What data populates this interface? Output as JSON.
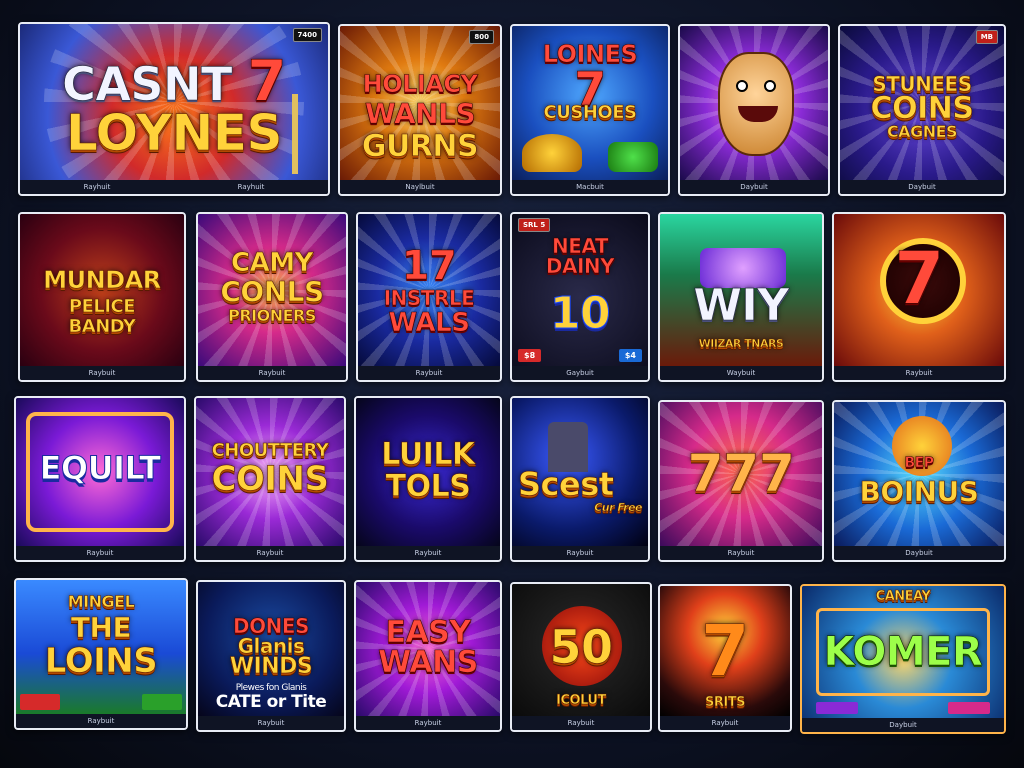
{
  "rows": [
    [
      {
        "title": "CASNT 7\nLOYNES",
        "badge": "7400",
        "caption": [
          "Rayhuit",
          "Rayhuit"
        ]
      },
      {
        "title": "HOLIACY\nWANLS\nGURNS",
        "badge": "800",
        "caption": [
          "Naylbuit"
        ]
      },
      {
        "title": "LOINES\n7\nCUSHOES",
        "caption": [
          "Macbuit"
        ]
      },
      {
        "title": "",
        "caption": [
          "Daybuit"
        ]
      },
      {
        "title": "STUNEES\nCOINS\nCAGNES",
        "badge": "MB",
        "caption": [
          "Daybuit"
        ]
      }
    ],
    [
      {
        "title": "MUNDAR\nPELICE\nBANDY",
        "caption": [
          "Raybuit"
        ]
      },
      {
        "title": "CAMY\nCONLS\nPRIONERS",
        "caption": [
          "Raybuit"
        ]
      },
      {
        "title": "17\nINSTRLE\nWALS",
        "caption": [
          "Raybuit"
        ]
      },
      {
        "title": "NEAT\nDAINY\n10",
        "badge": "SRL 5",
        "btn_left": "$8",
        "btn_right": "$4",
        "caption": [
          "Gaybuit"
        ]
      },
      {
        "title": "WIY\nWIIZAR TNARS",
        "caption": [
          "Waybuit"
        ]
      },
      {
        "title": "7",
        "caption": [
          "Raybuit"
        ]
      }
    ],
    [
      {
        "title": "EQUILT",
        "caption": [
          "Raybuit"
        ]
      },
      {
        "title": "CHOUTTERY\nCOINS",
        "caption": [
          "Raybuit"
        ]
      },
      {
        "title": "LUILK\nTOLS",
        "caption": [
          "Raybuit"
        ]
      },
      {
        "title": "Scest\nCur Free",
        "caption": [
          "Raybuit"
        ]
      },
      {
        "title": "777",
        "caption": [
          "Raybuit"
        ]
      },
      {
        "title": "BEP\nBOINUS",
        "caption": [
          "Daybuit"
        ]
      }
    ],
    [
      {
        "title": "MINGEL\nTHE\nLOINS",
        "caption": [
          "Raybuit"
        ]
      },
      {
        "title": "DONES\nGlanis\nWINDS\nPlewes fon Glanis\nCATE or Tite",
        "caption": [
          "Raybuit"
        ]
      },
      {
        "title": "EASY\nWANS",
        "caption": [
          "Raybuit"
        ]
      },
      {
        "title": "50\nICOLUT",
        "caption": [
          "Raybuit"
        ]
      },
      {
        "title": "7\nSRITS",
        "caption": [
          "Raybuit"
        ]
      },
      {
        "title": "CANEAY\nKOMER",
        "caption": [
          "Daybuit"
        ]
      }
    ]
  ],
  "labels": {
    "r1c1_line1": "CASNT",
    "r1c1_seven": "7",
    "r1c1_line2": "LOYNES",
    "r1c1_badge": "7400",
    "r1c1_cap_a": "Rayhuit",
    "r1c1_cap_b": "Rayhuit",
    "r1c2_line1": "HOLIACY",
    "r1c2_line2": "WANLS",
    "r1c2_line3": "GURNS",
    "r1c2_badge": "800",
    "r1c2_cap": "Naylbuit",
    "r1c3_line1": "LOINES",
    "r1c3_seven": "7",
    "r1c3_line2": "CUSHOES",
    "r1c3_cap": "Macbuit",
    "r1c4_cap": "Daybuit",
    "r1c5_line1": "STUNEES",
    "r1c5_line2": "COINS",
    "r1c5_line3": "CAGNES",
    "r1c5_badge": "MB",
    "r1c5_cap": "Daybuit",
    "r2c1_line1": "MUNDAR",
    "r2c1_line2": "PELICE",
    "r2c1_line3": "BANDY",
    "r2c1_cap": "Raybuit",
    "r2c2_line1": "CAMY",
    "r2c2_line2": "CONLS",
    "r2c2_line3": "PRIONERS",
    "r2c2_cap": "Raybuit",
    "r2c3_line1": "17",
    "r2c3_line2": "INSTRLE",
    "r2c3_line3": "WALS",
    "r2c3_cap": "Raybuit",
    "r2c4_badge": "SRL 5",
    "r2c4_line1": "NEAT",
    "r2c4_line2": "DAINY",
    "r2c4_num": "10",
    "r2c4_btn_l": "$8",
    "r2c4_btn_r": "$4",
    "r2c4_cap": "Gaybuit",
    "r2c5_line1": "WIY",
    "r2c5_line2": "WIIZAR TNARS",
    "r2c5_cap": "Waybuit",
    "r2c6_seven": "7",
    "r2c6_cap": "Raybuit",
    "r3c1_line1": "EQUILT",
    "r3c1_cap": "Raybuit",
    "r3c2_line1": "CHOUTTERY",
    "r3c2_line2": "COINS",
    "r3c2_cap": "Raybuit",
    "r3c3_line1": "LUILK",
    "r3c3_line2": "TOLS",
    "r3c3_cap": "Raybuit",
    "r3c4_line1": "Scest",
    "r3c4_line2": "Cur Free",
    "r3c4_cap": "Raybuit",
    "r3c5_line1": "777",
    "r3c5_cap": "Raybuit",
    "r3c6_line1": "BEP",
    "r3c6_line2": "BOINUS",
    "r3c6_cap": "Daybuit",
    "r4c1_line1": "MINGEL",
    "r4c1_line2": "THE",
    "r4c1_line3": "LOINS",
    "r4c1_cap": "Raybuit",
    "r4c2_line1": "DONES",
    "r4c2_line2": "Glanis",
    "r4c2_line3": "WINDS",
    "r4c2_line4": "Plewes fon Glanis",
    "r4c2_line5": "CATE or Tite",
    "r4c2_cap": "Raybuit",
    "r4c3_line1": "EASY",
    "r4c3_line2": "WANS",
    "r4c3_cap": "Raybuit",
    "r4c4_num": "50",
    "r4c4_line1": "ICOLUT",
    "r4c4_cap": "Raybuit",
    "r4c5_seven": "7",
    "r4c5_line1": "SRITS",
    "r4c5_cap": "Raybuit",
    "r4c6_line1": "CANEAY",
    "r4c6_line2": "KOMER",
    "r4c6_cap": "Daybuit"
  },
  "colors": {
    "background": "#0b1020",
    "tile_border": "#e8ecf5",
    "gold": "#ffd23a",
    "red": "#ff4a3a",
    "purple": "#7a2bd6",
    "blue": "#1f6bd6"
  }
}
